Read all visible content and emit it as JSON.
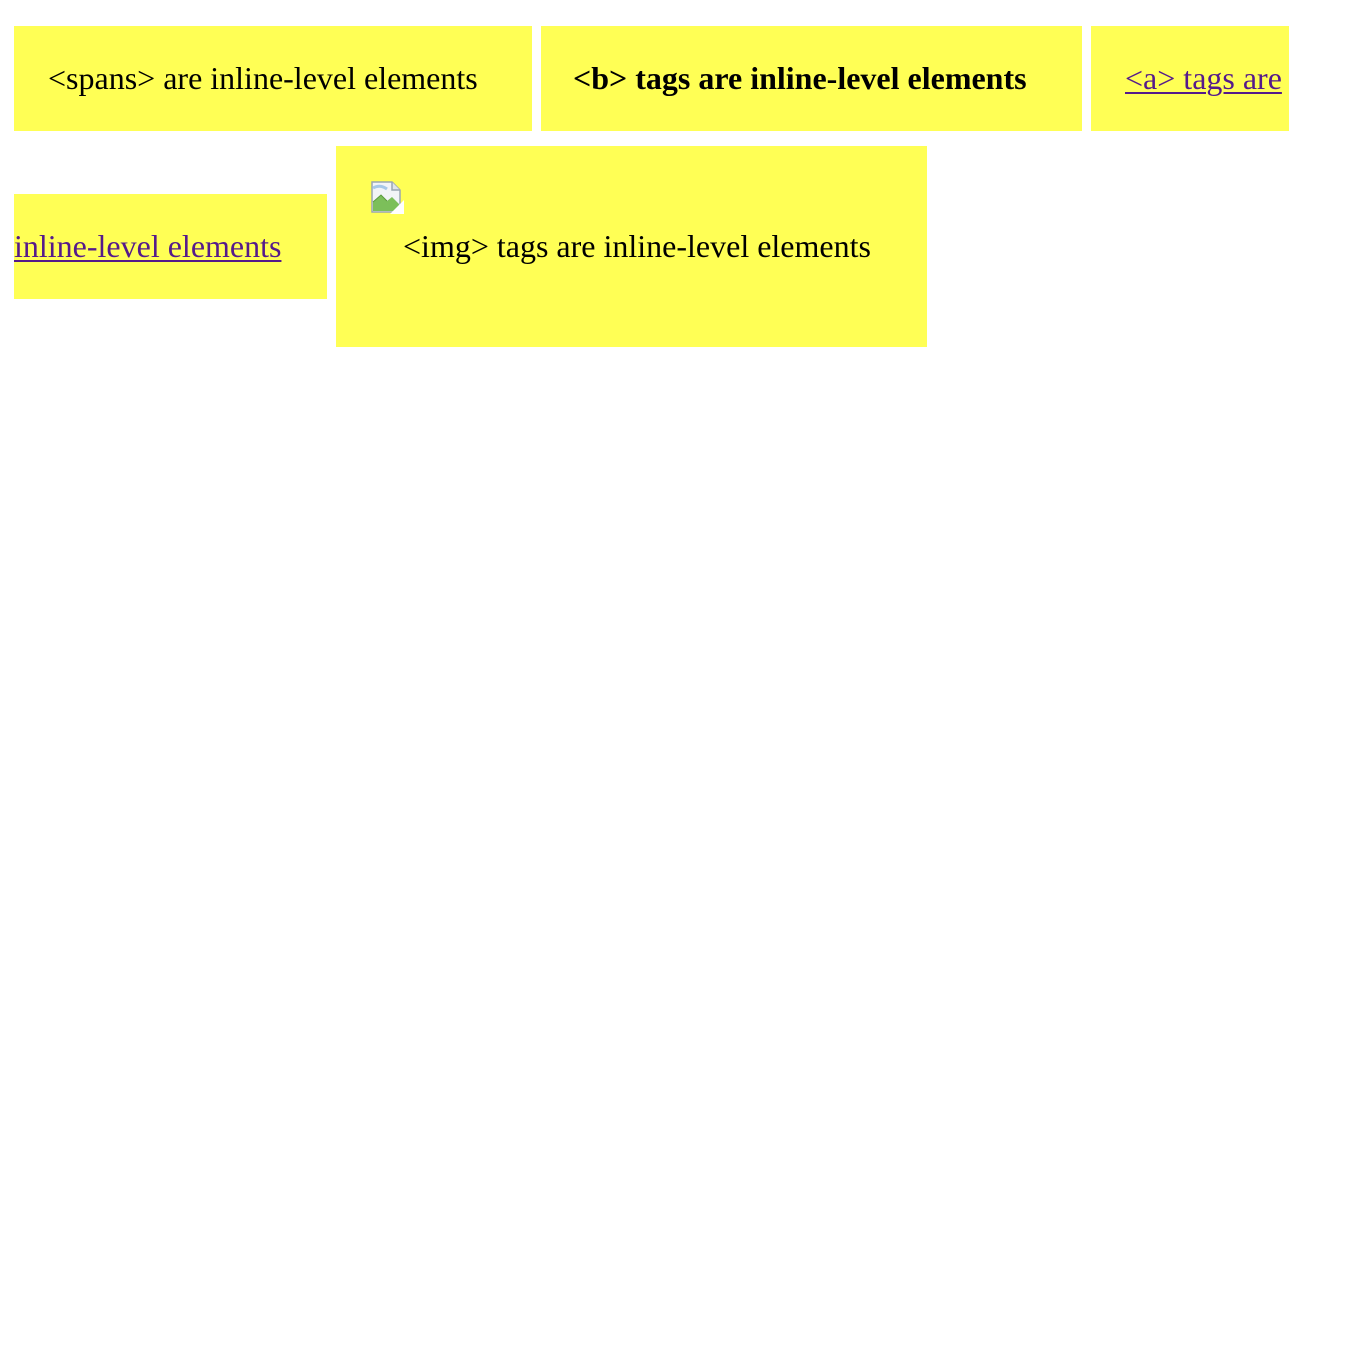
{
  "elements": {
    "span_text": "<spans> are inline-level elements",
    "b_text": "<b> tags are inline-level elements",
    "a_text_line1": "<a> tags are",
    "a_text_line2": "inline-level elements",
    "img_text": "<img> tags are inline-level elements",
    "broken_image_icon": "broken-image-icon"
  },
  "colors": {
    "box_background": "#ffff55",
    "link_visited": "#551a8b",
    "text": "#000000",
    "page_background": "#ffffff"
  }
}
